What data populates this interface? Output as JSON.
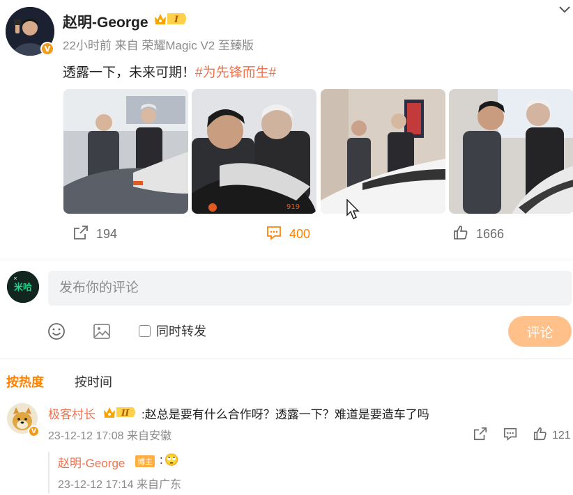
{
  "post": {
    "author": "赵明-George",
    "verified_mark": "V",
    "member_level": "I",
    "time": "22小时前",
    "source": "来自 荣耀Magic V2 至臻版",
    "text": "透露一下，未来可期！",
    "hashtag": "#为先锋而生#",
    "photos": [
      {
        "name": "photo-1",
        "icon": "photo-two-men-showroom"
      },
      {
        "name": "photo-2",
        "icon": "photo-two-men-closeup"
      },
      {
        "name": "photo-3",
        "icon": "photo-two-men-white-car"
      },
      {
        "name": "photo-4",
        "icon": "photo-two-men-talking"
      }
    ],
    "reposts": "194",
    "comments": "400",
    "likes": "1666"
  },
  "composer": {
    "placeholder": "发布你的评论",
    "avatar_text": "米哈",
    "repost_label": "同时转发",
    "submit_label": "评论"
  },
  "sort": {
    "hot_label": "按热度",
    "time_label": "按时间"
  },
  "comments": [
    {
      "user": "极客村长",
      "member_level": "II",
      "text": ":赵总是要有什么合作呀？透露一下？难道是要造车了吗",
      "meta": "23-12-12 17:08 来自安徽",
      "likes": "121",
      "replies": [
        {
          "user": "赵明-George",
          "badge": "博主",
          "text": ":",
          "emoji": "🙄",
          "meta": "23-12-12 17:14 来自广东"
        }
      ]
    }
  ],
  "colors": {
    "accent": "#ff8200",
    "link": "#eb7350",
    "submit_disabled": "#ffc08a"
  }
}
